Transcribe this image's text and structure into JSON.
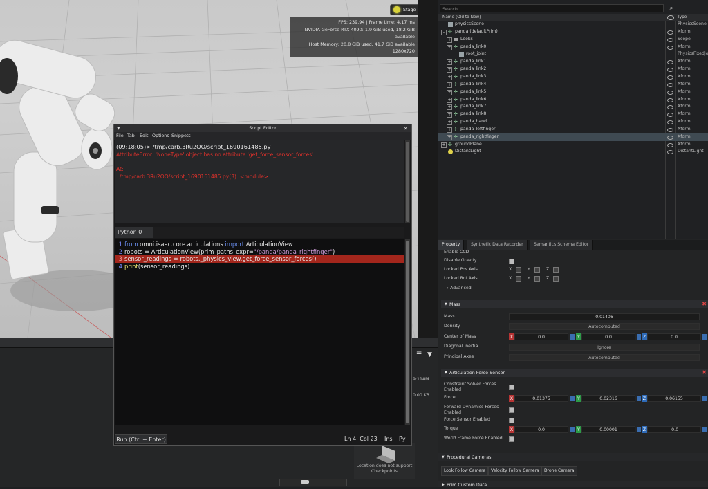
{
  "viewport": {
    "stage_lights_label": "Stage Lights",
    "hud": {
      "line1": "FPS: 239.94 | Frame time: 4.17 ms",
      "line2": "NVIDIA GeForce RTX 4090: 1.9 GiB used, 18.2 GiB available",
      "line3": "Host Memory: 20.8 GiB used, 41.7 GiB available",
      "line4": "1280x720"
    }
  },
  "stage": {
    "search_placeholder": "Search",
    "header": {
      "name": "Name (Old to New)",
      "type": "Type"
    },
    "rows": [
      {
        "name": "physicsScene",
        "type": "PhysicsScene"
      },
      {
        "name": "panda (defaultPrim)",
        "type": "Xform"
      },
      {
        "name": "Looks",
        "type": "Scope"
      },
      {
        "name": "panda_link0",
        "type": "Xform"
      },
      {
        "name": "root_joint",
        "type": "PhysicsFixedJo"
      },
      {
        "name": "panda_link1",
        "type": "Xform"
      },
      {
        "name": "panda_link2",
        "type": "Xform"
      },
      {
        "name": "panda_link3",
        "type": "Xform"
      },
      {
        "name": "panda_link4",
        "type": "Xform"
      },
      {
        "name": "panda_link5",
        "type": "Xform"
      },
      {
        "name": "panda_link6",
        "type": "Xform"
      },
      {
        "name": "panda_link7",
        "type": "Xform"
      },
      {
        "name": "panda_link8",
        "type": "Xform"
      },
      {
        "name": "panda_hand",
        "type": "Xform"
      },
      {
        "name": "panda_leftfinger",
        "type": "Xform"
      },
      {
        "name": "panda_rightfinger",
        "type": "Xform"
      },
      {
        "name": "groundPlane",
        "type": "Xform"
      },
      {
        "name": "DistantLight",
        "type": "DistantLight"
      }
    ]
  },
  "property": {
    "tabs": [
      "Property",
      "Synthetic Data Recorder",
      "Semantics Schema Editor"
    ],
    "enable_ccd": "Enable CCD",
    "disable_gravity": "Disable Gravity",
    "locked_pos_axis": "Locked Pos Axis",
    "locked_rot_axis": "Locked Rot Axis",
    "axis_x": "X",
    "axis_y": "Y",
    "axis_z": "Z",
    "advanced": "Advanced",
    "mass_section": "Mass",
    "mass_label": "Mass",
    "mass_value": "0.01406",
    "density_label": "Density",
    "density_value": "Autocomputed",
    "com_label": "Center of Mass",
    "com_x": "0.0",
    "com_y": "0.0",
    "com_z": "0.0",
    "inertia_label": "Diagonal Inertia",
    "inertia_value": "Ignore",
    "principal_label": "Principal Axes",
    "principal_value": "Autocomputed",
    "afs_section": "Articulation Force Sensor",
    "csf_label_1": "Constraint Solver Forces",
    "csf_label_2": "Enabled",
    "force_label": "Force",
    "force_x": "0.01375",
    "force_y": "0.02316",
    "force_z": "0.06155",
    "fdf_label_1": "Forward Dynamics Forces",
    "fdf_label_2": "Enabled",
    "fse_label": "Force Sensor Enabled",
    "torque_label": "Torque",
    "torque_x": "0.0",
    "torque_y": "0.00001",
    "torque_z": "-0.0",
    "wfe_label": "World Frame Force Enabled",
    "proc_cam_section": "Procedural Cameras",
    "cam_buttons": [
      "Look Follow Camera",
      "Velocity Follow Camera",
      "Drone Camera"
    ],
    "prim_custom_section": "Prim Custom Data"
  },
  "editor": {
    "title": "Script Editor",
    "menu": [
      "File",
      "Tab",
      "Edit",
      "Options",
      "Snippets"
    ],
    "output": {
      "line1": "(09:18:05)> /tmp/carb.3Ru2OO/script_1690161485.py",
      "line2": "AttributeError: 'NoneType' object has no attribute 'get_force_sensor_forces'",
      "line3": "At:",
      "line4": "  /tmp/carb.3Ru2OO/script_1690161485.py(3): <module>"
    },
    "tab_label": "Python 0",
    "code": {
      "l1_kw1": "from",
      "l1_mod": " omni.isaac.core.articulations ",
      "l1_kw2": "import",
      "l1_cls": " ArticulationView",
      "l2_a": "robots = ArticulationView(prim_paths_expr=",
      "l2_str": "\"/panda/panda_rightfinger\"",
      "l2_b": ")",
      "l3": "sensor_readings = robots._physics_view.get_force_sensor_forces()",
      "l4_fn": "print",
      "l4_rest": "(sensor_readings)"
    },
    "run_label": "Run (Ctrl + Enter)",
    "cursor_pos": "Ln 4, Col 23",
    "ins_label": "Ins",
    "lang_label": "Py"
  },
  "background": {
    "time_snippet": "9:11AM",
    "size_snippet": "0.00 KB",
    "map_msg_1": "Location does not support",
    "map_msg_2": "Checkpoints"
  },
  "colors": {
    "error_red": "#e0312b",
    "highlight_line": "#a3261c",
    "keyword_blue": "#6a8ff0",
    "string_purple": "#d09dd9",
    "axis_x": "#b73434",
    "axis_y": "#2d9a48",
    "axis_z": "#2f6bb8"
  }
}
